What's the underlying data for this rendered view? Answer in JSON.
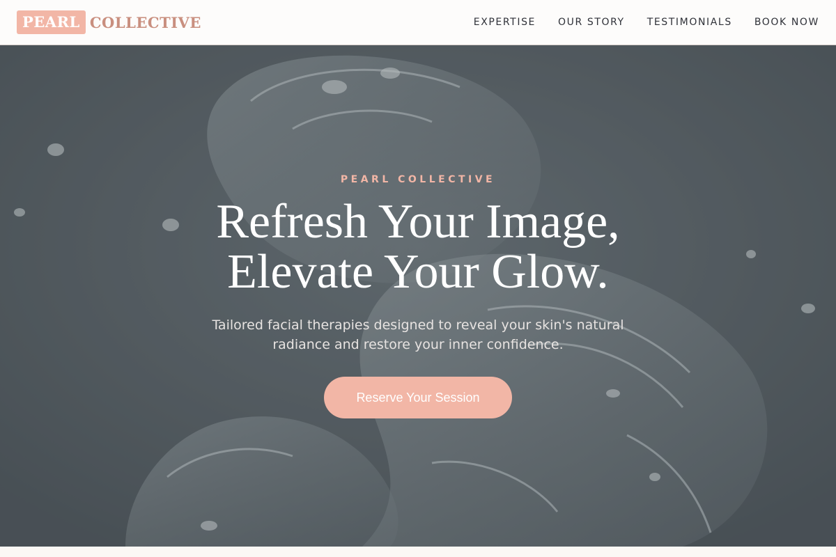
{
  "brand": {
    "logo_box": "PEARL",
    "logo_rest": "COLLECTIVE"
  },
  "nav": {
    "items": [
      {
        "label": "EXPERTISE"
      },
      {
        "label": "OUR STORY"
      },
      {
        "label": "TESTIMONIALS"
      },
      {
        "label": "BOOK NOW"
      }
    ]
  },
  "hero": {
    "eyebrow": "PEARL COLLECTIVE",
    "headline_line1": "Refresh Your Image,",
    "headline_line2": "Elevate Your Glow.",
    "subhead": "Tailored facial therapies designed to reveal your skin's natural radiance and restore your inner confidence.",
    "cta_label": "Reserve Your Session",
    "background": "water-splash-image"
  },
  "colors": {
    "accent": "#f2b6a6",
    "brand_text": "#c98f7f",
    "nav_text": "#2f3138",
    "hero_overlay": "#4f565b"
  }
}
